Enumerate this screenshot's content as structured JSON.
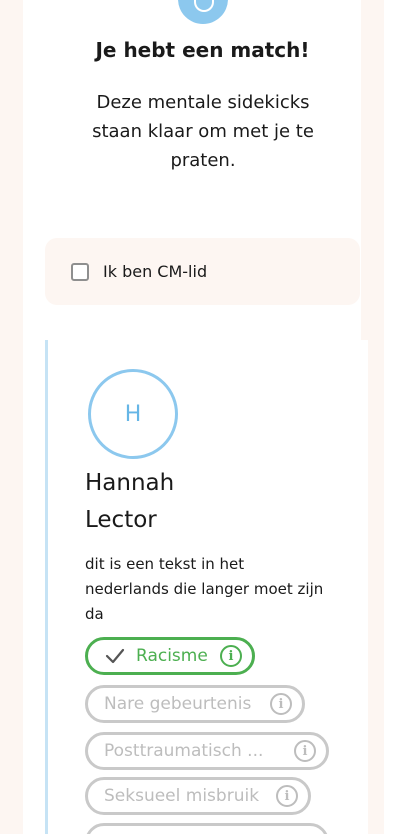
{
  "header": {
    "badge_icon": "smile-icon",
    "title": "Je hebt een match!",
    "subtitle": "Deze mentale sidekicks staan klaar om met je te praten."
  },
  "filter": {
    "checkbox_label": "Ik ben CM-lid",
    "checked": false
  },
  "sidekick": {
    "initial": "H",
    "first_name": "Hannah",
    "last_name": "Lector",
    "bio": "dit is een tekst in het nederlands die langer moet zijn da",
    "tags": [
      {
        "label": "Racisme",
        "selected": true
      },
      {
        "label": "Nare gebeurtenis",
        "selected": false
      },
      {
        "label": "Posttraumatisch ...",
        "selected": false
      },
      {
        "label": "Seksueel misbruik",
        "selected": false
      }
    ]
  },
  "colors": {
    "accent_blue": "#8cc8ee",
    "selected_green": "#4caf50",
    "inactive_gray": "#c9c9c9",
    "panel_bg": "#fdf6f2"
  }
}
